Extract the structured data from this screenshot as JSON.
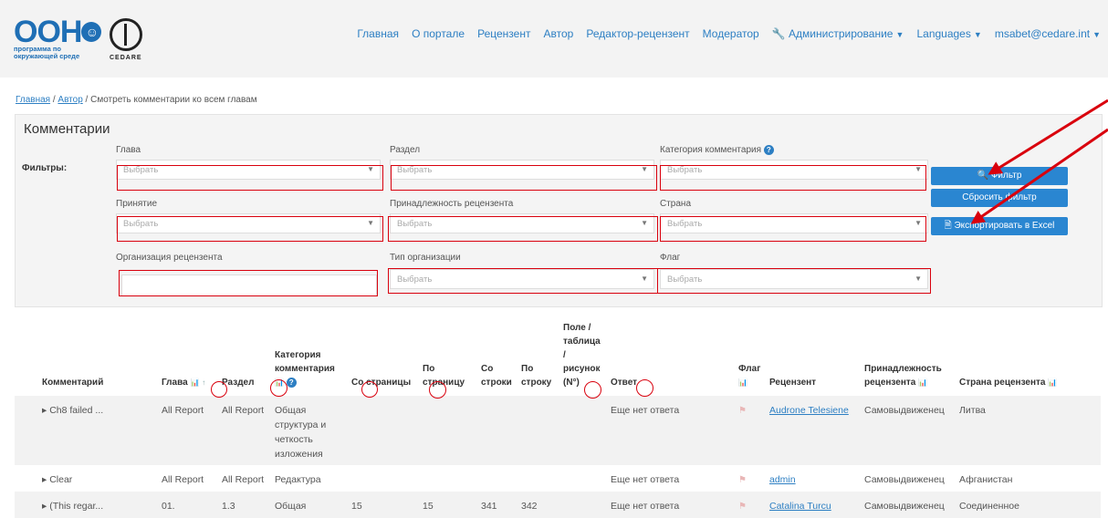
{
  "header": {
    "logo_un": "ООН",
    "logo_un_sub1": "программа по",
    "logo_un_sub2": "окружающей среде",
    "logo_cedare": "CEDARE",
    "nav": [
      "Главная",
      "О портале",
      "Рецензент",
      "Автор",
      "Редактор-рецензент",
      "Модератор"
    ],
    "admin": "Администрирование",
    "languages": "Languages",
    "user": "msabet@cedare.int"
  },
  "breadcrumb": {
    "home": "Главная",
    "author": "Автор",
    "current": "Смотреть комментарии ко всем главам"
  },
  "filters": {
    "title": "Комментарии",
    "label": "Фильтры:",
    "placeholder": "Выбрать",
    "chapter": "Глава",
    "section": "Раздел",
    "category": "Категория комментария",
    "acceptance": "Принятие",
    "affiliation": "Принадлежность рецензента",
    "country": "Страна",
    "organization": "Организация рецензента",
    "org_type": "Тип организации",
    "flag": "Флаг"
  },
  "buttons": {
    "filter": "Фильтр",
    "reset": "Сбросить фильтр",
    "export": "Экспортировать в Excel"
  },
  "table": {
    "headers": {
      "comment": "Комментарий",
      "chapter": "Глава",
      "section": "Раздел",
      "category": "Категория комментария",
      "from_page": "Со страницы",
      "to_page": "По страницу",
      "from_line": "Со строки",
      "to_line": "По строку",
      "field": "Поле / таблица / рисунок (N°)",
      "answer": "Ответ",
      "flag": "Флаг",
      "reviewer": "Рецензент",
      "affiliation": "Принадлежность рецензента",
      "country": "Страна рецензента"
    },
    "rows": [
      {
        "comment": "Ch8 failed ...",
        "chapter": "All Report",
        "section": "All Report",
        "category": "Общая структура и четкость изложения",
        "from_page": "",
        "to_page": "",
        "from_line": "",
        "to_line": "",
        "field": "",
        "answer": "Еще нет ответа",
        "reviewer": "Audrone Telesiene",
        "affiliation": "Самовыдвиженец",
        "country": "Литва"
      },
      {
        "comment": "Clear",
        "chapter": "All Report",
        "section": "All Report",
        "category": "Редактура",
        "from_page": "",
        "to_page": "",
        "from_line": "",
        "to_line": "",
        "field": "",
        "answer": "Еще нет ответа",
        "reviewer": "admin",
        "affiliation": "Самовыдвиженец",
        "country": "Афганистан"
      },
      {
        "comment": "(This regar...",
        "chapter": "01.",
        "section": "1.3",
        "category": "Общая",
        "from_page": "15",
        "to_page": "15",
        "from_line": "341",
        "to_line": "342",
        "field": "",
        "answer": "Еще нет ответа",
        "reviewer": "Catalina Turcu",
        "affiliation": "Самовыдвиженец",
        "country": "Соединенное"
      }
    ]
  }
}
